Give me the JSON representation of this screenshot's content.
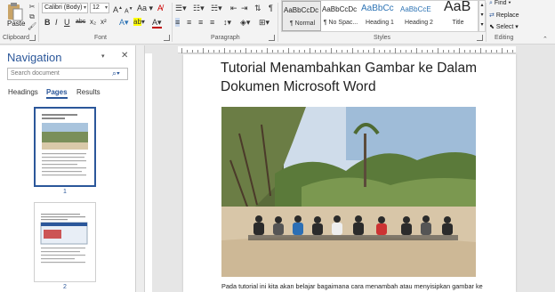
{
  "ribbon": {
    "clipboard": {
      "paste_label": "Paste",
      "group_label": "Clipboard"
    },
    "font": {
      "font_name": "Calibri (Body)",
      "font_size": "12",
      "group_label": "Font",
      "grow": "A",
      "shrink": "A",
      "case": "Aa",
      "bold": "B",
      "italic": "I",
      "underline": "U",
      "strike": "abc",
      "sub": "x₂",
      "sup": "x²",
      "effects": "A",
      "highlight": "ab",
      "color": "A"
    },
    "paragraph": {
      "group_label": "Paragraph",
      "pilcrow": "¶"
    },
    "styles": {
      "group_label": "Styles",
      "items": [
        {
          "preview": "AaBbCcDc",
          "name": "¶ Normal"
        },
        {
          "preview": "AaBbCcDc",
          "name": "¶ No Spac..."
        },
        {
          "preview": "AaBbCc",
          "name": "Heading 1"
        },
        {
          "preview": "AaBbCcE",
          "name": "Heading 2"
        },
        {
          "preview": "AaB",
          "name": "Title"
        }
      ]
    },
    "editing": {
      "group_label": "Editing",
      "find": "Find",
      "replace": "Replace",
      "select": "Select"
    }
  },
  "nav": {
    "title": "Navigation",
    "search_placeholder": "Search document",
    "tabs": [
      "Headings",
      "Pages",
      "Results"
    ],
    "pages": [
      "1",
      "2"
    ]
  },
  "document": {
    "title": "Tutorial Menambahkan Gambar ke Dalam Dokumen Microsoft Word",
    "body": "Pada tutorial ini kita akan belajar bagaimana cara menambah atau menyisipkan gambar ke"
  },
  "colors": {
    "accent": "#2b579a",
    "font_color": "#c00000",
    "highlight": "#ffff00"
  }
}
